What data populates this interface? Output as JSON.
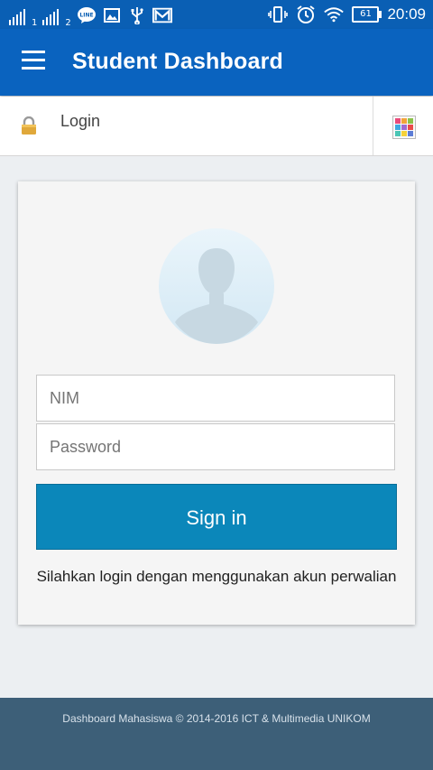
{
  "status_bar": {
    "sim1": "1",
    "sim2": "2",
    "battery": "61",
    "time": "20:09",
    "icons": [
      "signal-icon",
      "line-app-icon",
      "gallery-icon",
      "usb-icon",
      "gmail-icon",
      "vibrate-icon",
      "alarm-icon",
      "wifi-icon",
      "battery-icon"
    ]
  },
  "app_bar": {
    "title": "Student Dashboard",
    "menu_icon": "hamburger-menu-icon"
  },
  "sub_bar": {
    "label": "Login",
    "lock_icon": "lock-icon",
    "apps_icon": "apps-grid-icon"
  },
  "login_form": {
    "nim_placeholder": "NIM",
    "password_placeholder": "Password",
    "signin_label": "Sign in",
    "hint": "Silahkan login dengan menggunakan akun perwalian"
  },
  "footer": {
    "text": "Dashboard Mahasiswa © 2014-2016 ICT & Multimedia UNIKOM"
  },
  "colors": {
    "app_bar": "#0a63bf",
    "status_bar": "#0a5fb4",
    "button": "#0b87ba",
    "footer": "#3d5f78"
  }
}
